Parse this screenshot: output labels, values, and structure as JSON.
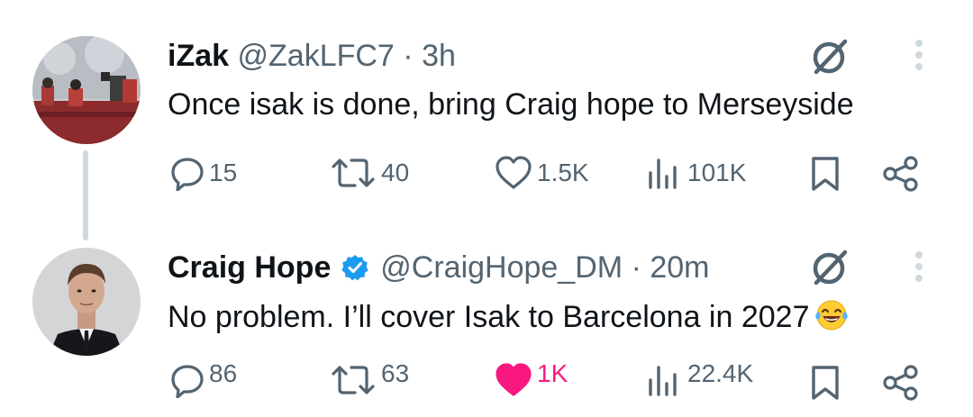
{
  "tweets": [
    {
      "display_name": "iZak",
      "handle": "@ZakLFC7",
      "separator": "·",
      "time": "3h",
      "text": "Once isak is done, bring Craig hope to Merseyside",
      "verified": false,
      "stats": {
        "replies": "15",
        "reposts": "40",
        "likes": "1.5K",
        "views": "101K"
      },
      "liked": false
    },
    {
      "display_name": "Craig Hope",
      "handle": "@CraigHope_DM",
      "separator": "·",
      "time": "20m",
      "text": "No problem. I’ll cover Isak to Barcelona in 2027",
      "emoji": "face-with-tears-of-joy",
      "verified": true,
      "stats": {
        "replies": "86",
        "reposts": "63",
        "likes": "1K",
        "views": "22.4K"
      },
      "liked": true
    }
  ],
  "icons": {
    "reply": "reply-icon",
    "repost": "repost-icon",
    "like": "heart-icon",
    "views": "views-icon",
    "bookmark": "bookmark-icon",
    "share": "share-icon",
    "grok": "grok-icon",
    "more": "more-vertical-icon",
    "verified": "verified-badge-icon"
  },
  "colors": {
    "text": "#0f1419",
    "muted": "#536471",
    "like_active": "#f91880",
    "verified": "#1d9bf0",
    "thread_line": "#cfd9de"
  }
}
